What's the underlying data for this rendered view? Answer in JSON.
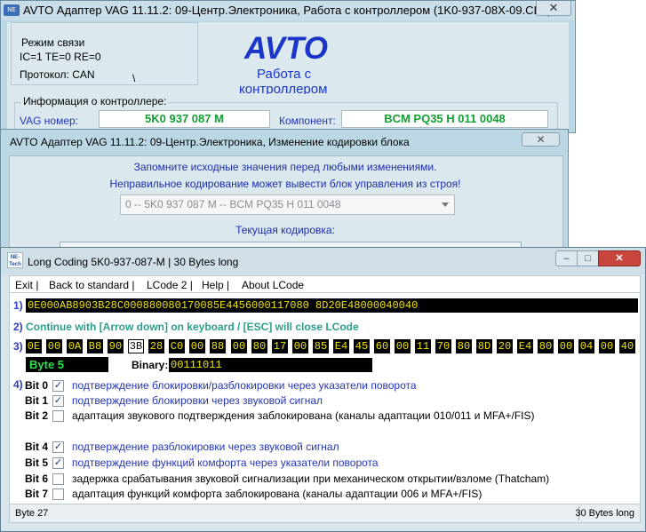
{
  "window_main": {
    "title": "AVTO Адаптер VAG 11.11.2: 09-Центр.Электроника,  Работа с контроллером (1K0-937-08X-09.CLB)",
    "close_glyph": "✕",
    "mode_label": "Режим связи",
    "ic_status": "IC=1  TE=0   RE=0",
    "protocol": "Протокол: CAN",
    "protocol_mark": "\\",
    "logo": "AVTO",
    "subtitle_line1": "Работа с",
    "subtitle_line2": "контроллером",
    "info_label": "Информация о контроллере:",
    "vag_label": "VAG номер:",
    "vag_value": "5K0 937 087 M",
    "component_label": "Компонент:",
    "component_value": "BCM PQ35 H      011 0048"
  },
  "window_coding": {
    "title": "AVTO Адаптер VAG 11.11.2: 09-Центр.Электроника,  Изменение кодировки блока",
    "close_glyph": "✕",
    "warning1": "Запомните исходные значения перед любыми изменениями.",
    "warning2": "Неправильное кодирование может вывести блок управления из строя!",
    "select_value": "0 -- 5K0 937 087 M -- BCM PQ35 H      011 0048",
    "current_coding_label": "Текущая кодировка:"
  },
  "window_lcode": {
    "icon_text": "NE-Tech",
    "title": "Long Coding  5K0-937-087-M | 30 Bytes long",
    "min_glyph": "–",
    "max_glyph": "□",
    "close_glyph": "✕",
    "menu": [
      "Exit |",
      "Back to standard |",
      "LCode 2 |",
      "Help |",
      "About LCode"
    ],
    "row1_num": "1)",
    "coding_string": "0E000AB8903B28C000880080170085E4456000117080 8D20E48000040040",
    "row2_num": "2)",
    "hint": "Continue with [Arrow down] on keyboard / [ESC] will close LCode",
    "row3_num": "3)",
    "bytes": [
      "0E",
      "00",
      "0A",
      "B8",
      "90",
      "3B",
      "28",
      "C0",
      "00",
      "88",
      "00",
      "80",
      "17",
      "00",
      "85",
      "E4",
      "45",
      "60",
      "00",
      "11",
      "70",
      "80",
      "8D",
      "20",
      "E4",
      "80",
      "00",
      "04",
      "00",
      "40"
    ],
    "selected_byte_index": 5,
    "byte_label": "Byte 5",
    "binary_label": "Binary:",
    "binary_value": "00111011",
    "row4_num": "4)",
    "bits": [
      {
        "label": "Bit 0",
        "checked": true,
        "text": "подтверждение блокировки/разблокировки через указатели поворота"
      },
      {
        "label": "Bit 1",
        "checked": true,
        "text": "подтверждение блокировки через звуковой сигнал"
      },
      {
        "label": "Bit 2",
        "checked": false,
        "text": "адаптация звукового подтверждения заблокирована (каналы адаптации 010/011 и MFA+/FIS)"
      },
      {
        "label": "Bit 4",
        "checked": true,
        "text": "подтверждение разблокировки через звуковой сигнал"
      },
      {
        "label": "Bit 5",
        "checked": true,
        "text": "подтверждение функций комфорта через указатели поворота"
      },
      {
        "label": "Bit 6",
        "checked": false,
        "text": "задержка срабатывания звуковой сигнализации при механическом открытии/взломе (Thatcham)"
      },
      {
        "label": "Bit 7",
        "checked": false,
        "text": "адаптация функций комфорта заблокирована (каналы адаптации 006 и MFA+/FIS)"
      }
    ],
    "check_glyph": "✓",
    "status_left": "Byte 27",
    "status_right": "30 Bytes long"
  }
}
